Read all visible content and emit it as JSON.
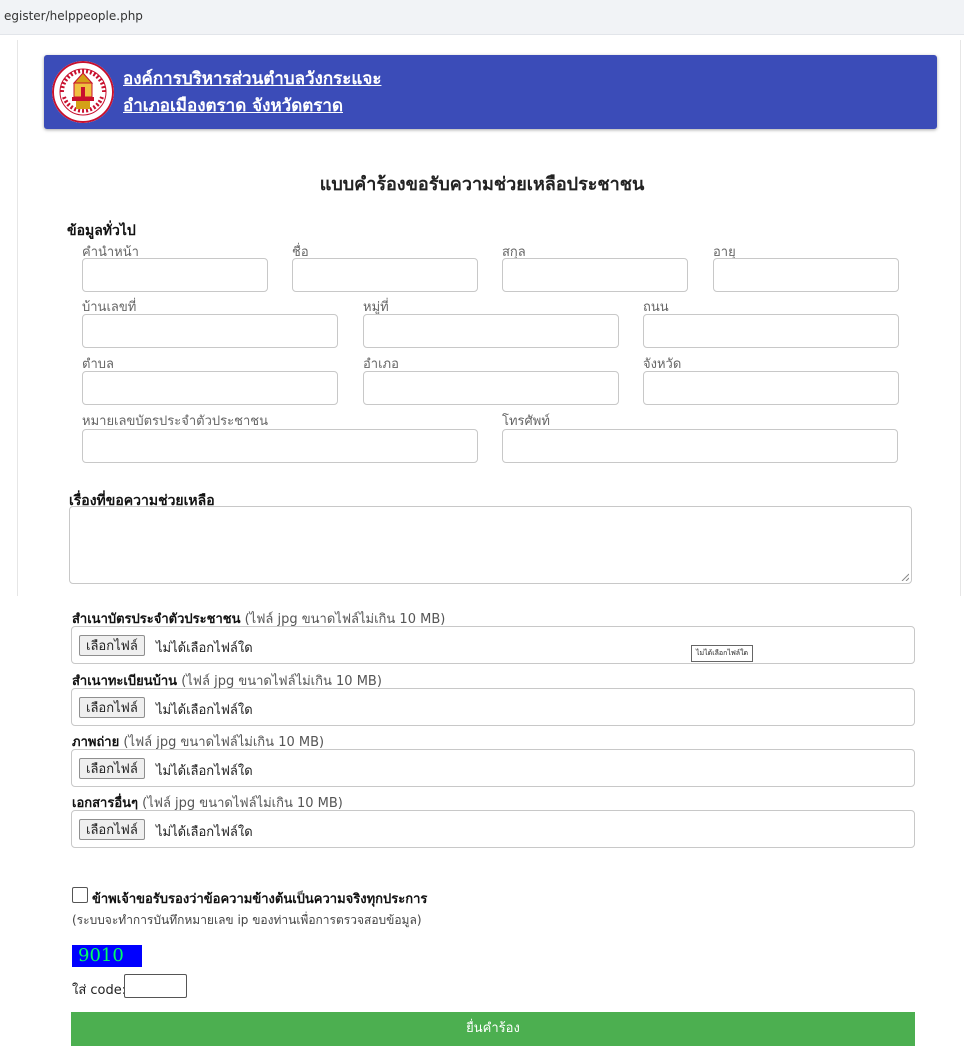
{
  "browser": {
    "url": "egister/helppeople.php"
  },
  "header": {
    "org_name": "องค์การบริหารส่วนตำบลวังกระแจะ",
    "location": "อำเภอเมืองตราด จังหวัดตราด"
  },
  "form": {
    "title": "แบบคำร้องขอรับความช่วยเหลือประชาชน",
    "general_section": "ข้อมูลทั่วไป",
    "fields": {
      "prefix": {
        "label": "คำนำหน้า",
        "value": ""
      },
      "first_name": {
        "label": "ชื่อ",
        "value": ""
      },
      "last_name": {
        "label": "สกุล",
        "value": ""
      },
      "age": {
        "label": "อายุ",
        "value": ""
      },
      "house_no": {
        "label": "บ้านเลขที่",
        "value": ""
      },
      "village_no": {
        "label": "หมู่ที่",
        "value": ""
      },
      "road": {
        "label": "ถนน",
        "value": ""
      },
      "subdistrict": {
        "label": "ตำบล",
        "value": ""
      },
      "district": {
        "label": "อำเภอ",
        "value": ""
      },
      "province": {
        "label": "จังหวัด",
        "value": ""
      },
      "id_card": {
        "label": "หมายเลขบัตรประจำตัวประชาชน",
        "value": ""
      },
      "phone": {
        "label": "โทรศัพท์",
        "value": ""
      }
    },
    "request_section": "เรื่องที่ขอความช่วยเหลือ",
    "request_text": ""
  },
  "uploads": [
    {
      "title": "สำเนาบัตรประจำตัวประชาชน",
      "hint": " (ไฟล์ jpg ขนาดไฟล์ไม่เกิน 10 MB)",
      "button": "เลือกไฟล์",
      "status": "ไม่ได้เลือกไฟล์ใด"
    },
    {
      "title": "สำเนาทะเบียนบ้าน",
      "hint": " (ไฟล์ jpg ขนาดไฟล์ไม่เกิน 10 MB)",
      "button": "เลือกไฟล์",
      "status": "ไม่ได้เลือกไฟล์ใด"
    },
    {
      "title": "ภาพถ่าย",
      "hint": " (ไฟล์ jpg ขนาดไฟล์ไม่เกิน 10 MB)",
      "button": "เลือกไฟล์",
      "status": "ไม่ได้เลือกไฟล์ใด"
    },
    {
      "title": "เอกสารอื่นๆ",
      "hint": " (ไฟล์ jpg ขนาดไฟล์ไม่เกิน 10 MB)",
      "button": "เลือกไฟล์",
      "status": "ไม่ได้เลือกไฟล์ใด"
    }
  ],
  "tooltip": "ไม่ได้เลือกไฟล์ใด",
  "certify": {
    "checked": false,
    "label": "ข้าพเจ้าขอรับรองว่าข้อความข้างต้นเป็นความจริงทุกประการ",
    "note": "(ระบบจะทำการบันทึกหมายเลข ip ของท่านเพื่อการตรวจสอบข้อมูล)"
  },
  "captcha": {
    "code": "9010",
    "label": "ใส่ code:",
    "value": ""
  },
  "submit_label": "ยื่นคำร้อง",
  "colors": {
    "header_bg": "#3b4cb8",
    "submit_bg": "#4caf50",
    "captcha_bg": "#0000ff",
    "captcha_text": "#00ff66"
  }
}
